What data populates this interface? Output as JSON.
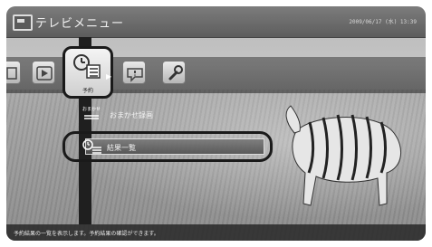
{
  "window": {
    "title": "テレビメニュー",
    "datetime": "2009/06/17 (水) 13:39"
  },
  "category_menu": {
    "selected_label": "予約",
    "icons": [
      "partial-icon",
      "play-icon",
      "clock-list-icon",
      "chat-icon",
      "wrench-icon"
    ]
  },
  "submenu": {
    "items": [
      {
        "tag": "おまかせ",
        "label": "おまかせ録画"
      },
      {
        "label": "結果一覧"
      }
    ]
  },
  "status": {
    "message": "予約結果の一覧を表示します。予約結果の確認ができます。"
  },
  "colors": {
    "title_bar": "#6a6a6a",
    "highlight_border": "#1a1a1a",
    "status_bar": "#282828"
  }
}
